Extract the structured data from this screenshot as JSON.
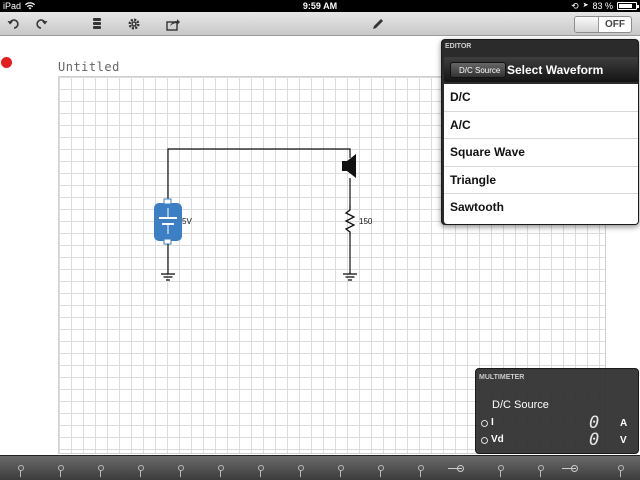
{
  "status_bar": {
    "device": "iPad",
    "time": "9:59 AM",
    "battery_percent": "83 %",
    "battery_level": 0.83
  },
  "toolbar": {
    "buttons": [
      "undo-icon",
      "redo-icon",
      "database-icon",
      "gear-icon",
      "share-icon",
      "pencil-icon"
    ],
    "toggle_label": "OFF"
  },
  "document": {
    "title": "Untitled"
  },
  "circuit": {
    "battery_label": "5V",
    "resistor_label": "150"
  },
  "editor": {
    "panel_title": "EDITOR",
    "back_label": "D/C Source",
    "nav_title": "Select Waveform",
    "waveforms": [
      "D/C",
      "A/C",
      "Square Wave",
      "Triangle",
      "Sawtooth"
    ]
  },
  "multimeter": {
    "panel_title": "MULTIMETER",
    "source_label": "D/C Source",
    "current": {
      "name": "I",
      "value": "0",
      "unit": "A"
    },
    "voltage": {
      "name": "Vd",
      "value": "0",
      "unit": "V"
    }
  },
  "colors": {
    "accent_blue": "#3d7fc4",
    "record_red": "#e41e1e",
    "toolbar_grey": "#d6d6d6",
    "panel_dark": "#2b2b2b"
  }
}
